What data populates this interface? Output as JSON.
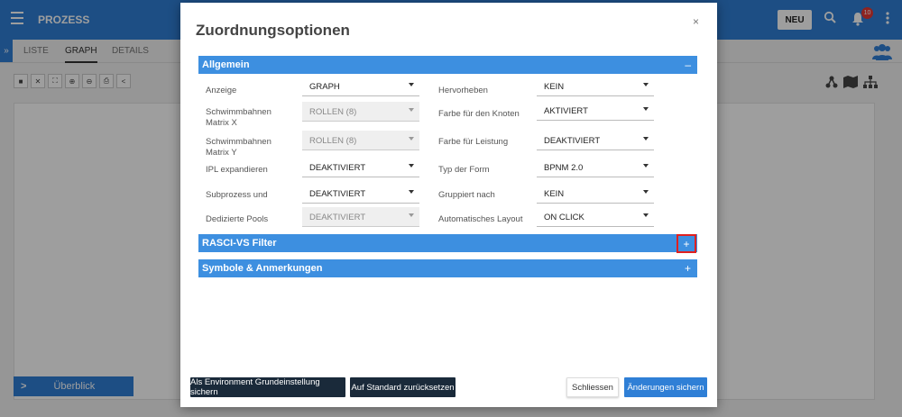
{
  "app": {
    "title": "PROZESS",
    "new_button": "NEU",
    "notification_count": "10"
  },
  "tabs": [
    {
      "label": "LISTE"
    },
    {
      "label": "GRAPH",
      "active": true
    },
    {
      "label": "DETAILS"
    }
  ],
  "overview": {
    "label": "Überblick"
  },
  "modal": {
    "title": "Zuordnungsoptionen",
    "close": "×",
    "sections": {
      "allgemein": {
        "label": "Allgemein",
        "toggle": "–"
      },
      "rasci": {
        "label": "RASCI-VS Filter",
        "toggle": "+"
      },
      "symbole": {
        "label": "Symbole & Anmerkungen",
        "toggle": "+"
      }
    },
    "left_fields": [
      {
        "label": "Anzeige",
        "value": "GRAPH",
        "disabled": false
      },
      {
        "label": "Schwimmbahnen Matrix X",
        "value": "ROLLEN (8)",
        "disabled": true
      },
      {
        "label": "Schwimmbahnen Matrix Y",
        "value": "ROLLEN (8)",
        "disabled": true
      },
      {
        "label": "IPL expandieren",
        "value": "DEAKTIVIERT",
        "disabled": false
      },
      {
        "label": "Subprozess und",
        "value": "DEAKTIVIERT",
        "disabled": false
      },
      {
        "label": "Dedizierte Pools",
        "value": "DEAKTIVIERT",
        "disabled": true
      }
    ],
    "right_fields": [
      {
        "label": "Hervorheben",
        "value": "KEIN"
      },
      {
        "label": "Farbe für den Knoten",
        "value": "AKTIVIERT"
      },
      {
        "label": "Farbe für Leistung",
        "value": "DEAKTIVIERT"
      },
      {
        "label": "Typ der Form",
        "value": "BPNM 2.0"
      },
      {
        "label": "Gruppiert nach",
        "value": "KEIN"
      },
      {
        "label": "Automatisches Layout",
        "value": "ON CLICK"
      }
    ],
    "buttons": {
      "save_default": "Als Environment Grundeinstellung sichern",
      "reset": "Auf Standard zurücksetzen",
      "close": "Schliessen",
      "save": "Änderungen sichern"
    }
  },
  "colors": {
    "primary": "#2f7fd6",
    "section": "#3d8fe0",
    "highlight": "#e0201f",
    "dark_button": "#1a2a3a"
  }
}
